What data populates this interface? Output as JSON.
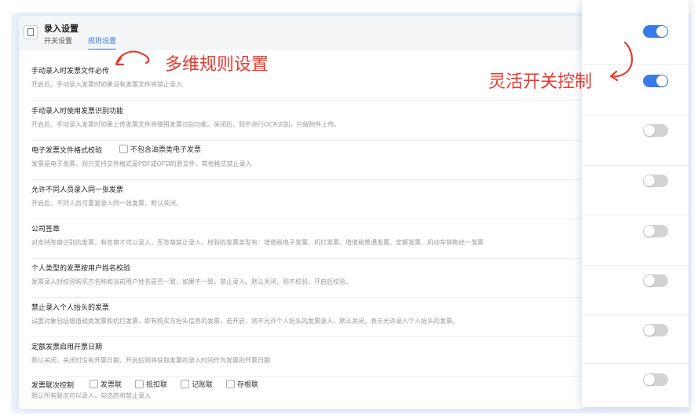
{
  "header": {
    "title": "录入设置",
    "tabs": [
      {
        "label": "开关设置",
        "active": false
      },
      {
        "label": "规则设置",
        "active": true
      }
    ]
  },
  "rows": [
    {
      "title": "手动录入时发票文件必传",
      "desc": "开启后，手动录入发票时如果没有发票文件将禁止录入",
      "toggle": true
    },
    {
      "title": "手动录入时使用发票识别功能",
      "desc": "开启后，手动录入发票时如果上传发票文件将使用发票识别功能。关闭后，则不进行OCR识别，只做附件上传。",
      "toggle": true
    },
    {
      "title": "电子发票文件格式校验",
      "checkbox": "不包含油票类电子发票",
      "desc": "发票是电子发票，则只支持文件格式是PDF或OFD的原文件，其他格式禁止录入",
      "toggle": false
    },
    {
      "title": "允许不同人员录入同一张发票",
      "desc": "开启后，不同人员可重复录入同一张发票，默认关闭。",
      "toggle": false
    },
    {
      "title": "公司签章",
      "desc": "对支持签章识别的发票，有签章才可以录入，无签章禁止录入，校验的发票类型有：增值税电子发票、机打发票、增值税普通发票、定额发票、机动车销售统一发票",
      "toggle": false
    },
    {
      "title": "个人类型的发票按用户姓名校验",
      "desc": "发票录入时校验购买方名称和当前用户姓名是否一致，如果不一致，禁止录入。默认关闭，则不校验，开启后校验。",
      "toggle": false
    },
    {
      "title": "禁止录入个人抬头的发票",
      "desc": "设置对象包括增值税类发票和机打发票，即有购买方抬头信息的发票，若开启，则不允许个人抬头的发票录入，默认关闭，表示允许录入个人抬头的发票。",
      "toggle": false
    },
    {
      "title": "定额发票启用开票日期",
      "desc": "默认关闭，关闭时没有开票日期，开启后则将获取发票的录入时间作为发票的开票日期",
      "toggle": false
    },
    {
      "title": "发票联次控制",
      "checkboxes": [
        "发票联",
        "抵扣联",
        "记账联",
        "存根联"
      ],
      "desc": "默认所有联次可以录入，勾选的将禁止录入",
      "toggle": false
    }
  ],
  "annotations": {
    "a1": "多维规则设置",
    "a2": "灵活开关控制"
  },
  "colors": {
    "accent": "#3b7be8",
    "annotation": "#e8392e"
  }
}
